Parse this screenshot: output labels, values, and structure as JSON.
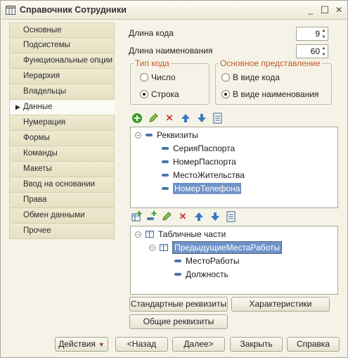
{
  "window": {
    "title": "Справочник Сотрудники",
    "controls": {
      "minimize": "_",
      "maximize": "☐",
      "close": "✕"
    }
  },
  "nav": {
    "items": [
      {
        "label": "Основные"
      },
      {
        "label": "Подсистемы"
      },
      {
        "label": "Функциональные опции"
      },
      {
        "label": "Иерархия"
      },
      {
        "label": "Владельцы"
      },
      {
        "label": "Данные",
        "active": true
      },
      {
        "label": "Нумерация"
      },
      {
        "label": "Формы"
      },
      {
        "label": "Команды"
      },
      {
        "label": "Макеты"
      },
      {
        "label": "Ввод на основании"
      },
      {
        "label": "Права"
      },
      {
        "label": "Обмен данными"
      },
      {
        "label": "Прочее"
      }
    ]
  },
  "fields": {
    "code_length_label": "Длина кода",
    "code_length_value": "9",
    "name_length_label": "Длина наименования",
    "name_length_value": "60"
  },
  "code_type": {
    "legend": "Тип кода",
    "options": [
      "Число",
      "Строка"
    ],
    "selected": "Строка"
  },
  "main_representation": {
    "legend": "Основное представление",
    "options": [
      "В виде кода",
      "В виде наименования"
    ],
    "selected": "В виде наименования"
  },
  "attributes_tree": {
    "root": "Реквизиты",
    "items": [
      "СерияПаспорта",
      "НомерПаспорта",
      "МестоЖительства",
      "НомерТелефона"
    ],
    "selected": "НомерТелефона"
  },
  "tabular_tree": {
    "root": "Табличные части",
    "table": "ПредыдущиеМестаРаботы",
    "items": [
      "МестоРаботы",
      "Должность"
    ]
  },
  "buttons": {
    "standard_attributes": "Стандартные реквизиты",
    "characteristics": "Характеристики",
    "common_attributes": "Общие реквизиты",
    "actions": "Действия",
    "back": "<Назад",
    "next": "Далее>",
    "close": "Закрыть",
    "help": "Справка"
  },
  "colors": {
    "accent_legend": "#c05a2c",
    "selection": "#6f93c8",
    "add_icon": "#3a9a2a",
    "delete_icon": "#d0302a",
    "arrow_icon": "#3b78c4"
  }
}
